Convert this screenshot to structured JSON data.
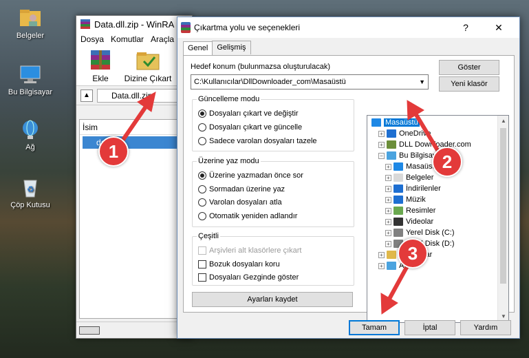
{
  "desktop": {
    "icons": [
      {
        "label": "Belgeler",
        "icon": "folder-user-icon"
      },
      {
        "label": "Bu Bilgisayar",
        "icon": "computer-icon"
      },
      {
        "label": "Ağ",
        "icon": "network-icon"
      },
      {
        "label": "Çöp Kutusu",
        "icon": "recycle-bin-icon"
      }
    ]
  },
  "winrar": {
    "title": "Data.dll.zip - WinRA",
    "menu": [
      "Dosya",
      "Komutlar",
      "Araçla"
    ],
    "toolbar": {
      "add": "Ekle",
      "extract": "Dizine Çıkart"
    },
    "path": "Data.dll.zip",
    "column_name": "İsim",
    "row": "da"
  },
  "dialog": {
    "title": "Çıkartma yolu ve seçenekleri",
    "help": "?",
    "close": "✕",
    "tabs": [
      "Genel",
      "Gelişmiş"
    ],
    "dest_label": "Hedef konum (bulunmazsa oluşturulacak)",
    "dest_value": "C:\\Kullanıcılar\\DllDownloader_com\\Masaüstü",
    "show_button": "Göster",
    "new_folder_button": "Yeni klasör",
    "update_group": {
      "title": "Güncelleme modu",
      "options": [
        {
          "label": "Dosyaları çıkart ve değiştir",
          "selected": true
        },
        {
          "label": "Dosyaları çıkart ve güncelle",
          "selected": false
        },
        {
          "label": "Sadece varolan dosyaları tazele",
          "selected": false
        }
      ]
    },
    "overwrite_group": {
      "title": "Üzerine yaz modu",
      "options": [
        {
          "label": "Üzerine yazmadan önce sor",
          "selected": true
        },
        {
          "label": "Sormadan üzerine yaz",
          "selected": false
        },
        {
          "label": "Varolan dosyaları atla",
          "selected": false
        },
        {
          "label": "Otomatik yeniden adlandır",
          "selected": false
        }
      ]
    },
    "misc_group": {
      "title": "Çeşitli",
      "options": [
        {
          "label": "Arşivleri alt klasörlere çıkart",
          "checked": false,
          "disabled": true
        },
        {
          "label": "Bozuk dosyaları koru",
          "checked": false,
          "disabled": false
        },
        {
          "label": "Dosyaları Gezginde göster",
          "checked": false,
          "disabled": false
        }
      ]
    },
    "save_settings": "Ayarları kaydet",
    "tree": [
      {
        "label": "Masaüstü",
        "depth": 0,
        "selected": true,
        "expander": "",
        "icon": "desktop-icon",
        "color": "#1e88e5"
      },
      {
        "label": "OneDrive",
        "depth": 1,
        "selected": false,
        "expander": "+",
        "icon": "onedrive-icon",
        "color": "#1e6fd1"
      },
      {
        "label": "DLL Downloader.com",
        "depth": 1,
        "selected": false,
        "expander": "+",
        "icon": "user-icon",
        "color": "#6b8e3a"
      },
      {
        "label": "Bu Bilgisayar",
        "depth": 1,
        "selected": false,
        "expander": "−",
        "icon": "computer-icon",
        "color": "#4aa3df"
      },
      {
        "label": "Masaüstü",
        "depth": 2,
        "selected": false,
        "expander": "+",
        "icon": "desktop-icon",
        "color": "#1e88e5"
      },
      {
        "label": "Belgeler",
        "depth": 2,
        "selected": false,
        "expander": "+",
        "icon": "documents-icon",
        "color": "#d9d9d9"
      },
      {
        "label": "İndirilenler",
        "depth": 2,
        "selected": false,
        "expander": "+",
        "icon": "downloads-icon",
        "color": "#1e6fd1"
      },
      {
        "label": "Müzik",
        "depth": 2,
        "selected": false,
        "expander": "+",
        "icon": "music-icon",
        "color": "#1e6fd1"
      },
      {
        "label": "Resimler",
        "depth": 2,
        "selected": false,
        "expander": "+",
        "icon": "pictures-icon",
        "color": "#6aa84f"
      },
      {
        "label": "Videolar",
        "depth": 2,
        "selected": false,
        "expander": "+",
        "icon": "videos-icon",
        "color": "#333333"
      },
      {
        "label": "Yerel Disk (C:)",
        "depth": 2,
        "selected": false,
        "expander": "+",
        "icon": "drive-c-icon",
        "color": "#808080"
      },
      {
        "label": "Yerel Disk (D:)",
        "depth": 2,
        "selected": false,
        "expander": "+",
        "icon": "drive-d-icon",
        "color": "#808080"
      },
      {
        "label": "Kitaplıklar",
        "depth": 1,
        "selected": false,
        "expander": "+",
        "icon": "libraries-icon",
        "color": "#e0b84a"
      },
      {
        "label": "Ağ",
        "depth": 1,
        "selected": false,
        "expander": "+",
        "icon": "network-icon",
        "color": "#4aa3df"
      }
    ],
    "ok": "Tamam",
    "cancel": "İptal",
    "help_button": "Yardım"
  },
  "annotations": {
    "badges": [
      "1",
      "2",
      "3"
    ],
    "color": "#e33a3a"
  }
}
